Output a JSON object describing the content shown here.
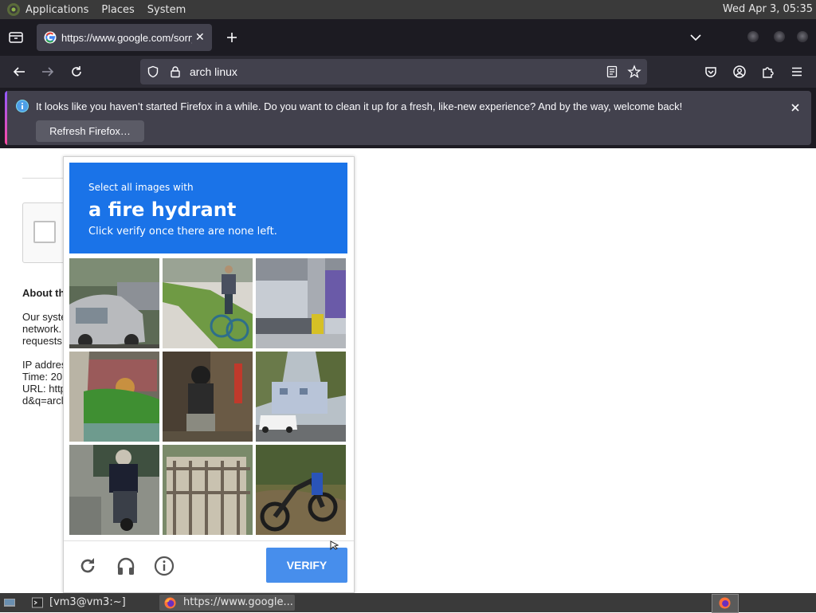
{
  "top_panel": {
    "menus": [
      "Applications",
      "Places",
      "System"
    ],
    "clock": "Wed Apr  3, 05:35"
  },
  "browser": {
    "tab_title": "https://www.google.com/sorry/index?continue",
    "urlbar_text": "arch linux"
  },
  "notification": {
    "message": "It looks like you haven’t started Firefox in a while. Do you want to clean it up for a fresh, like-new experience? And by the way, welcome back!",
    "button": "Refresh Firefox…"
  },
  "page": {
    "about_heading": "About th",
    "lines": [
      "Our syste",
      "network.",
      "requests",
      "IP addres",
      "Time: 20",
      "URL: http",
      "d&q=arcl"
    ]
  },
  "captcha": {
    "instruction_small": "Select all images with",
    "target": "a fire hydrant",
    "instruction_sub": "Click verify once there are none left.",
    "verify_label": "VERIFY",
    "header_color": "#1a73e8"
  },
  "taskbar": {
    "items": [
      "[vm3@vm3:~]",
      "https://www.google..."
    ]
  }
}
